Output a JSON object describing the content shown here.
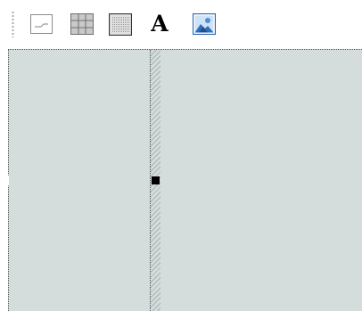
{
  "toolbar": {
    "tools": [
      {
        "icon": "line-icon"
      },
      {
        "icon": "table-grid-icon"
      },
      {
        "icon": "rectangle-frame-icon"
      },
      {
        "icon": "text-icon",
        "glyph": "A"
      },
      {
        "icon": "image-icon"
      }
    ]
  },
  "colors": {
    "canvas_background": "#d4dcdc",
    "border_dotted": "#555555",
    "handle": "#000000"
  }
}
